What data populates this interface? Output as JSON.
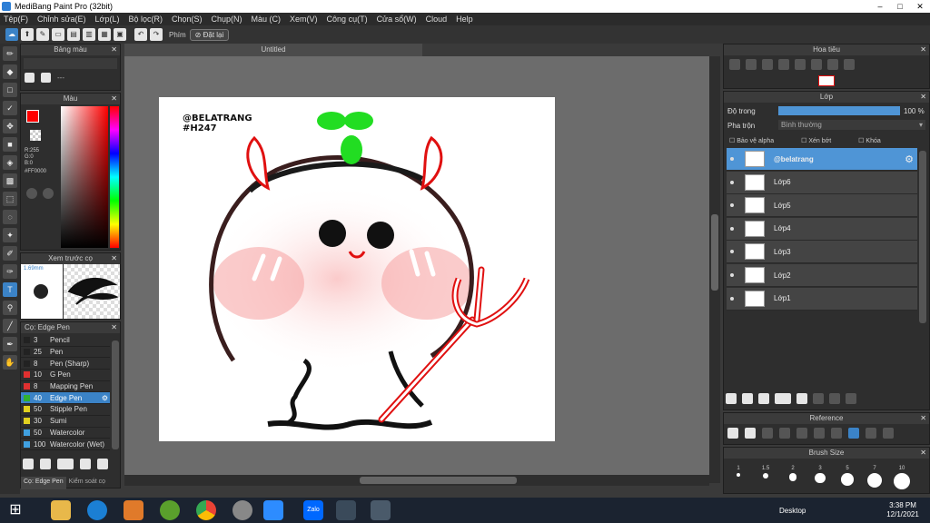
{
  "titlebar": {
    "title": "MediBang Paint Pro (32bit)",
    "min": "–",
    "max": "□",
    "close": "✕"
  },
  "menu": [
    "Tệp(F)",
    "Chỉnh sửa(E)",
    "Lớp(L)",
    "Bộ lọc(R)",
    "Chọn(S)",
    "Chụp(N)",
    "Màu (C)",
    "Xem(V)",
    "Công cụ(T)",
    "Cửa sổ(W)",
    "Cloud",
    "Help"
  ],
  "toolbar": {
    "phim_label": "Phím",
    "reset_label": "Đặt lại"
  },
  "document": {
    "tab_title": "Untitled",
    "watermark_line1": "@BELATRANG",
    "watermark_line2": "#H247"
  },
  "panels": {
    "color_palette": {
      "title": "Bảng màu",
      "dash": "---"
    },
    "color": {
      "title": "Màu",
      "r": "R:255",
      "g": "G:0",
      "b": "B:0",
      "hex": "#FF0000",
      "primary": "#ff0000"
    },
    "brush_preview": {
      "title": "Xem trước cọ",
      "size": "1.69mm"
    },
    "brush_list": {
      "title": "Cọ: Edge Pen",
      "items": [
        {
          "size": "3",
          "name": "Pencil",
          "color": "#222222"
        },
        {
          "size": "25",
          "name": "Pen",
          "color": "#222222"
        },
        {
          "size": "8",
          "name": "Pen (Sharp)",
          "color": "#222222"
        },
        {
          "size": "10",
          "name": "G Pen",
          "color": "#e03030"
        },
        {
          "size": "8",
          "name": "Mapping Pen",
          "color": "#e03030"
        },
        {
          "size": "40",
          "name": "Edge Pen",
          "color": "#30b030"
        },
        {
          "size": "50",
          "name": "Stipple Pen",
          "color": "#e0d020"
        },
        {
          "size": "30",
          "name": "Sumi",
          "color": "#e0d020"
        },
        {
          "size": "50",
          "name": "Watercolor",
          "color": "#40a0e0"
        },
        {
          "size": "100",
          "name": "Watercolor (Wet)",
          "color": "#40a0e0"
        }
      ],
      "tab1": "Cọ: Edge Pen",
      "tab2": "Kiểm soát cọ"
    },
    "navigator": {
      "title": "Hoa tiêu"
    },
    "layers": {
      "title": "Lớp",
      "opacity_label": "Độ trong",
      "opacity_value": "100 %",
      "opacity_fraction": 1.0,
      "blend_label": "Pha trộn",
      "blend_value": "Bình thường",
      "protect_alpha": "Bảo vệ alpha",
      "clipping": "Xén bớt",
      "lock": "Khóa",
      "items": [
        {
          "name": "@belatrang",
          "selected": true
        },
        {
          "name": "Lớp6",
          "selected": false
        },
        {
          "name": "Lớp5",
          "selected": false
        },
        {
          "name": "Lớp4",
          "selected": false
        },
        {
          "name": "Lớp3",
          "selected": false
        },
        {
          "name": "Lớp2",
          "selected": false
        },
        {
          "name": "Lớp1",
          "selected": false
        }
      ]
    },
    "reference": {
      "title": "Reference"
    },
    "brush_size": {
      "title": "Brush Size",
      "sizes": [
        "1",
        "1.5",
        "2",
        "3",
        "5",
        "7",
        "10"
      ]
    }
  },
  "taskbar": {
    "desktop_label": "Desktop",
    "time": "3:38 PM",
    "date": "12/1/2021",
    "zalo": "Zalo"
  }
}
